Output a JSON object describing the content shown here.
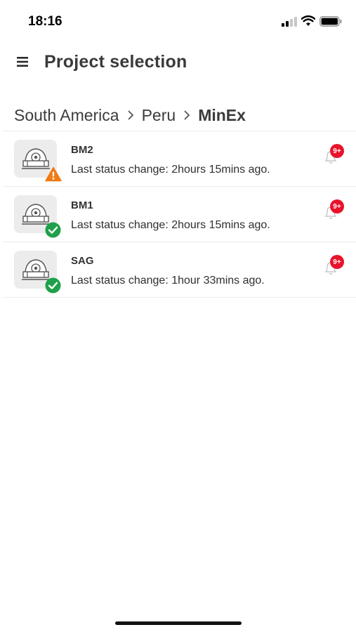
{
  "status_bar": {
    "time": "18:16"
  },
  "header": {
    "title": "Project selection",
    "menu_icon": "hamburger-menu-icon"
  },
  "breadcrumb": [
    {
      "label": "South America"
    },
    {
      "label": "Peru"
    },
    {
      "label": "MinEx"
    }
  ],
  "projects": [
    {
      "name": "BM2",
      "status_text": "Last status change: 2hours 15mins ago.",
      "state_icon": "warning-icon",
      "notifications": "9+"
    },
    {
      "name": "BM1",
      "status_text": "Last status change: 2hours 15mins ago.",
      "state_icon": "check-icon",
      "notifications": "9+"
    },
    {
      "name": "SAG",
      "status_text": "Last status change: 1hour 33mins ago.",
      "state_icon": "check-icon",
      "notifications": "9+"
    }
  ],
  "colors": {
    "warning": "#f07a13",
    "ok": "#1fa04a",
    "notification": "#e8132b",
    "thumb_bg": "#ececec"
  }
}
